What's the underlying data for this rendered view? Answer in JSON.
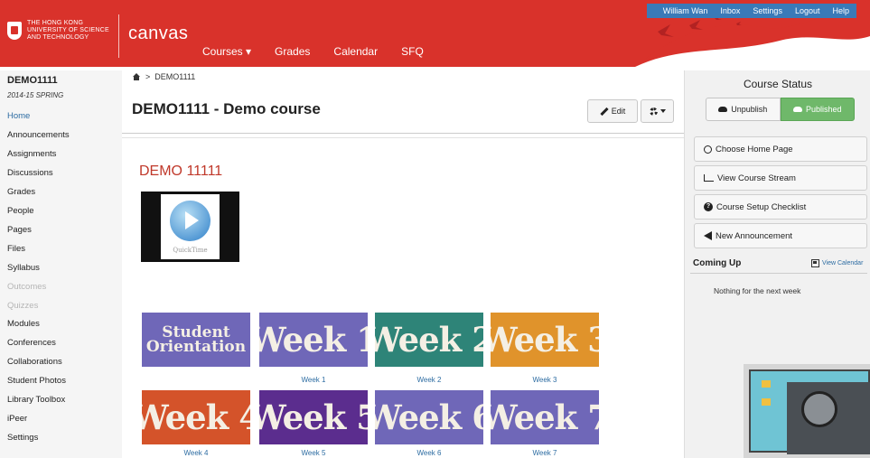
{
  "header": {
    "university": [
      "THE HONG KONG",
      "UNIVERSITY OF SCIENCE",
      "AND TECHNOLOGY"
    ],
    "brand": "canvas",
    "nav": [
      "Courses ▾",
      "Grades",
      "Calendar",
      "SFQ"
    ],
    "user_nav": [
      "William Wan",
      "Inbox",
      "Settings",
      "Logout",
      "Help"
    ],
    "colors": {
      "banner": "#d9322b",
      "user_bar": "#3a7ab8"
    }
  },
  "sidebar": {
    "course": "DEMO1111",
    "term": "2014-15 SPRING",
    "items": [
      {
        "label": "Home",
        "state": "active"
      },
      {
        "label": "Announcements",
        "state": "normal"
      },
      {
        "label": "Assignments",
        "state": "normal"
      },
      {
        "label": "Discussions",
        "state": "normal"
      },
      {
        "label": "Grades",
        "state": "normal"
      },
      {
        "label": "People",
        "state": "normal"
      },
      {
        "label": "Pages",
        "state": "normal"
      },
      {
        "label": "Files",
        "state": "normal"
      },
      {
        "label": "Syllabus",
        "state": "normal"
      },
      {
        "label": "Outcomes",
        "state": "disabled"
      },
      {
        "label": "Quizzes",
        "state": "disabled"
      },
      {
        "label": "Modules",
        "state": "normal"
      },
      {
        "label": "Conferences",
        "state": "normal"
      },
      {
        "label": "Collaborations",
        "state": "normal"
      },
      {
        "label": "Student Photos",
        "state": "normal"
      },
      {
        "label": "Library Toolbox",
        "state": "normal"
      },
      {
        "label": "iPeer",
        "state": "normal"
      },
      {
        "label": "Settings",
        "state": "normal"
      }
    ]
  },
  "breadcrumb": {
    "separator": ">",
    "current": "DEMO1111"
  },
  "main": {
    "title": "DEMO1111 - Demo course",
    "edit_label": "Edit",
    "content_heading": "DEMO 11111",
    "quicktime_label": "QuickTime",
    "tiles": [
      {
        "text": "Student Orientation",
        "caption": "",
        "color": "#6f67b8"
      },
      {
        "text": "Week 1",
        "caption": "Week 1",
        "color": "#6f67b8"
      },
      {
        "text": "Week 2",
        "caption": "Week 2",
        "color": "#2e8478"
      },
      {
        "text": "Week 3",
        "caption": "Week 3",
        "color": "#e0932b"
      },
      {
        "text": "Week 4",
        "caption": "Week 4",
        "color": "#d4532a"
      },
      {
        "text": "Week 5",
        "caption": "Week 5",
        "color": "#5b2d8e"
      },
      {
        "text": "Week 6",
        "caption": "Week 6",
        "color": "#6f67b8"
      },
      {
        "text": "Week 7",
        "caption": "Week 7",
        "color": "#6f67b8"
      }
    ]
  },
  "right": {
    "title": "Course Status",
    "unpublish": "Unpublish",
    "published": "Published",
    "buttons": [
      "Choose Home Page",
      "View Course Stream",
      "Course Setup Checklist",
      "New Announcement"
    ],
    "coming_up": "Coming Up",
    "view_calendar": "View Calendar",
    "nothing": "Nothing for the next week"
  }
}
